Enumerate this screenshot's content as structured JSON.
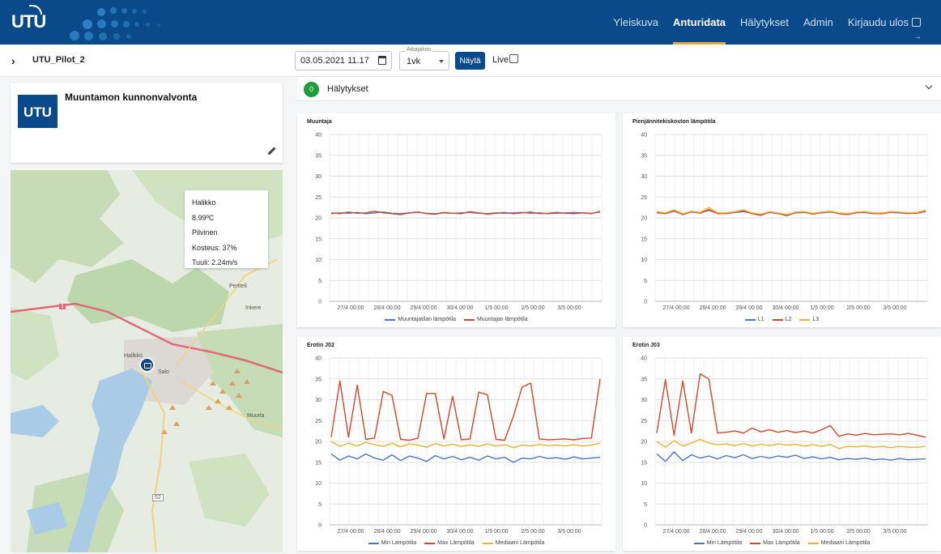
{
  "app": {
    "logo_text": "UTU",
    "nav": [
      {
        "label": "Yleiskuva",
        "active": false
      },
      {
        "label": "Anturidata",
        "active": true
      },
      {
        "label": "Hälytykset",
        "active": false
      },
      {
        "label": "Admin",
        "active": false
      },
      {
        "label": "Kirjaudu ulos",
        "active": false
      }
    ]
  },
  "toolbar": {
    "site": "UTU_Pilot_2",
    "date_value": "03.05.2021 11.17",
    "period_label": "Aikajakso",
    "period_value": "1vk",
    "show_button": "Näytä",
    "live_label": "Live"
  },
  "info_card": {
    "logo_text": "UTU",
    "title": "Muuntamon kunnonvalvonta"
  },
  "weather": {
    "place": "Halikko",
    "temperature": "8.99ºC",
    "condition": "Pilvinen",
    "humidity": "Kosteus: 37%",
    "wind": "Tuuli: 2.24m/s"
  },
  "map_labels": [
    "Pertteli",
    "Inkere",
    "Halikko",
    "Salo",
    "Muurla",
    "1",
    "52"
  ],
  "alarms": {
    "count": "0",
    "label": "Hälytykset"
  },
  "colors": {
    "brand": "#0a4a8a",
    "accent": "#f2a53a",
    "blue": "#4a74c9",
    "red": "#d2472b",
    "yellow": "#efb130",
    "dark_red": "#a8322a",
    "alarm_ok": "#1e9e3a"
  },
  "chart_data": [
    {
      "type": "line",
      "title": "Muuntaja",
      "ylim": [
        0,
        40
      ],
      "yticks": [
        0,
        5,
        10,
        15,
        20,
        25,
        30,
        35,
        40
      ],
      "xticks": [
        "27/4 00:00",
        "28/4 00:00",
        "29/4 00:00",
        "30/4 00:00",
        "1/5 00:00",
        "2/5 00:00",
        "3/5 00:00"
      ],
      "grid": true,
      "legend": "bottom",
      "series": [
        {
          "name": "Muuntajatilan lämpötila",
          "color": "#4a74c9",
          "values": [
            21,
            21.2,
            21.1,
            21.3,
            21.0,
            21.2,
            21.4,
            21.1,
            21.0,
            21.2,
            21.3,
            21.1,
            21.0,
            21.2,
            21.1,
            21.2,
            21.3,
            21.1,
            21.0,
            21.2,
            21.1,
            21.2,
            21.3,
            21.1,
            21.2,
            21.0,
            21.1,
            21.2,
            21.3,
            21.2,
            21.1,
            21.4
          ]
        },
        {
          "name": "Muuntajan lämpötila",
          "color": "#d2472b",
          "values": [
            21.2,
            21.0,
            21.4,
            21.1,
            21.2,
            21.6,
            21.2,
            21.0,
            20.8,
            21.2,
            21.4,
            21.0,
            20.9,
            21.3,
            21.1,
            21.0,
            21.5,
            21.2,
            20.9,
            21.1,
            21.3,
            21.0,
            21.2,
            21.4,
            21.0,
            21.1,
            21.3,
            21.1,
            21.0,
            21.2,
            21.0,
            21.6
          ]
        }
      ]
    },
    {
      "type": "line",
      "title": "Pienjännitekiskoston lämpötila",
      "ylim": [
        0,
        40
      ],
      "yticks": [
        0,
        5,
        10,
        15,
        20,
        25,
        30,
        35,
        40
      ],
      "xticks": [
        "27/4 00:00",
        "28/4 00:00",
        "29/4 00:00",
        "30/4 00:00",
        "1/5 00:00",
        "2/5 00:00",
        "3/5 00:00"
      ],
      "grid": true,
      "legend": "bottom",
      "series": [
        {
          "name": "L1",
          "color": "#4a74c9",
          "values": [
            21.3,
            21.0,
            21.6,
            20.9,
            21.4,
            21.2,
            21.8,
            21.1,
            21.0,
            21.3,
            21.5,
            21.1,
            20.8,
            21.3,
            21.0,
            20.7,
            21.2,
            21.3,
            21.0,
            21.2,
            21.4,
            21.1,
            20.9,
            21.2,
            21.3,
            21.0,
            21.1,
            21.3,
            21.2,
            21.0,
            21.2,
            21.5
          ]
        },
        {
          "name": "L2",
          "color": "#d2472b",
          "values": [
            21.2,
            21.1,
            21.7,
            20.8,
            21.5,
            21.1,
            22.0,
            21.0,
            21.1,
            21.4,
            21.7,
            21.0,
            20.6,
            21.4,
            21.1,
            20.5,
            21.3,
            21.4,
            20.9,
            21.3,
            21.5,
            21.0,
            20.8,
            21.3,
            21.4,
            21.1,
            21.0,
            21.4,
            21.3,
            21.1,
            21.1,
            21.6
          ]
        },
        {
          "name": "L3",
          "color": "#efb130",
          "values": [
            21.5,
            21.2,
            21.9,
            21.0,
            21.6,
            21.3,
            22.5,
            21.2,
            21.2,
            21.5,
            21.9,
            21.2,
            20.9,
            21.5,
            21.2,
            20.8,
            21.4,
            21.5,
            21.1,
            21.4,
            21.6,
            21.2,
            21.0,
            21.4,
            21.5,
            21.2,
            21.2,
            21.5,
            21.4,
            21.2,
            21.3,
            21.8
          ]
        }
      ]
    },
    {
      "type": "line",
      "title": "Erotin J02",
      "ylim": [
        0,
        40
      ],
      "yticks": [
        0,
        5,
        10,
        15,
        20,
        25,
        30,
        35,
        40
      ],
      "xticks": [
        "27/4 00:00",
        "28/4 00:00",
        "29/4 00:00",
        "30/4 00:00",
        "1/5 00:00",
        "2/5 00:00",
        "3/5 00:00"
      ],
      "grid": true,
      "legend": "bottom",
      "series": [
        {
          "name": "Min Lämpötila",
          "color": "#4a74c9",
          "values": [
            17,
            15.5,
            16.5,
            15.8,
            17,
            16,
            15.5,
            16.8,
            15.4,
            16.5,
            16,
            15.2,
            16.6,
            15.8,
            16.4,
            15.6,
            16.2,
            15.5,
            16.5,
            15.8,
            16.2,
            15.0,
            16.0,
            15.8,
            16.4,
            15.9,
            16.1,
            15.7,
            16.3,
            15.8,
            16.0,
            16.2
          ]
        },
        {
          "name": "Max Lämpötila",
          "color": "#d2472b",
          "values": [
            21,
            34.5,
            21,
            33.5,
            20.5,
            20.8,
            32,
            31,
            20.5,
            20.3,
            20.8,
            31.5,
            31.5,
            20.6,
            30.8,
            20.4,
            20.6,
            31.8,
            31.2,
            20.5,
            20.3,
            26,
            33,
            34,
            20.6,
            20.4,
            20.5,
            20.6,
            20.4,
            20.7,
            20.8,
            35
          ]
        },
        {
          "name": "Mediaani Lämpötila",
          "color": "#efb130",
          "values": [
            20,
            18.8,
            19.6,
            18.9,
            19.8,
            19.2,
            18.8,
            19.6,
            18.7,
            19.4,
            19.1,
            18.6,
            19.5,
            18.9,
            19.3,
            18.8,
            19.2,
            18.8,
            19.4,
            18.9,
            19.2,
            18.5,
            19.1,
            18.9,
            19.3,
            19.0,
            19.1,
            18.9,
            19.2,
            18.9,
            19.1,
            19.6
          ]
        }
      ]
    },
    {
      "type": "line",
      "title": "Erotin J03",
      "ylim": [
        0,
        40
      ],
      "yticks": [
        0,
        5,
        10,
        15,
        20,
        25,
        30,
        35,
        40
      ],
      "xticks": [
        "27/4 00:00",
        "28/4 00:00",
        "29/4 00:00",
        "30/4 00:00",
        "1/5 00:00",
        "2/5 00:00",
        "3/5 00:00"
      ],
      "grid": true,
      "legend": "bottom",
      "series": [
        {
          "name": "Min Lämpötila",
          "color": "#4a74c9",
          "values": [
            17,
            15.2,
            17.5,
            15.4,
            16.8,
            16.0,
            16.5,
            15.8,
            16.6,
            16.1,
            16.8,
            15.9,
            16.4,
            16.0,
            16.5,
            16.2,
            16.7,
            15.9,
            16.3,
            15.8,
            16.2,
            15.6,
            15.9,
            15.7,
            16.0,
            15.6,
            15.8,
            15.5,
            15.9,
            15.6,
            15.7,
            15.8
          ]
        },
        {
          "name": "Max Lämpötila",
          "color": "#d2472b",
          "values": [
            22,
            34.8,
            21.5,
            34.5,
            22,
            36.2,
            35,
            22,
            22.2,
            22.5,
            22.0,
            23.2,
            22.3,
            22.8,
            22.2,
            22.6,
            22.1,
            22.5,
            22.0,
            22.8,
            23.8,
            21.2,
            21.8,
            21.5,
            21.9,
            21.6,
            21.7,
            21.8,
            21.6,
            21.9,
            21.5,
            21.0
          ]
        },
        {
          "name": "Mediaani Lämpötila",
          "color": "#efb130",
          "values": [
            20,
            18.6,
            20.2,
            18.9,
            19.6,
            20.5,
            19.6,
            19.2,
            19.4,
            19.0,
            19.5,
            18.9,
            19.3,
            19.0,
            19.4,
            19.1,
            19.3,
            18.9,
            19.2,
            18.8,
            19.3,
            18.3,
            18.8,
            18.7,
            18.9,
            18.6,
            18.8,
            18.5,
            18.8,
            18.6,
            18.6,
            18.8
          ]
        }
      ]
    }
  ]
}
